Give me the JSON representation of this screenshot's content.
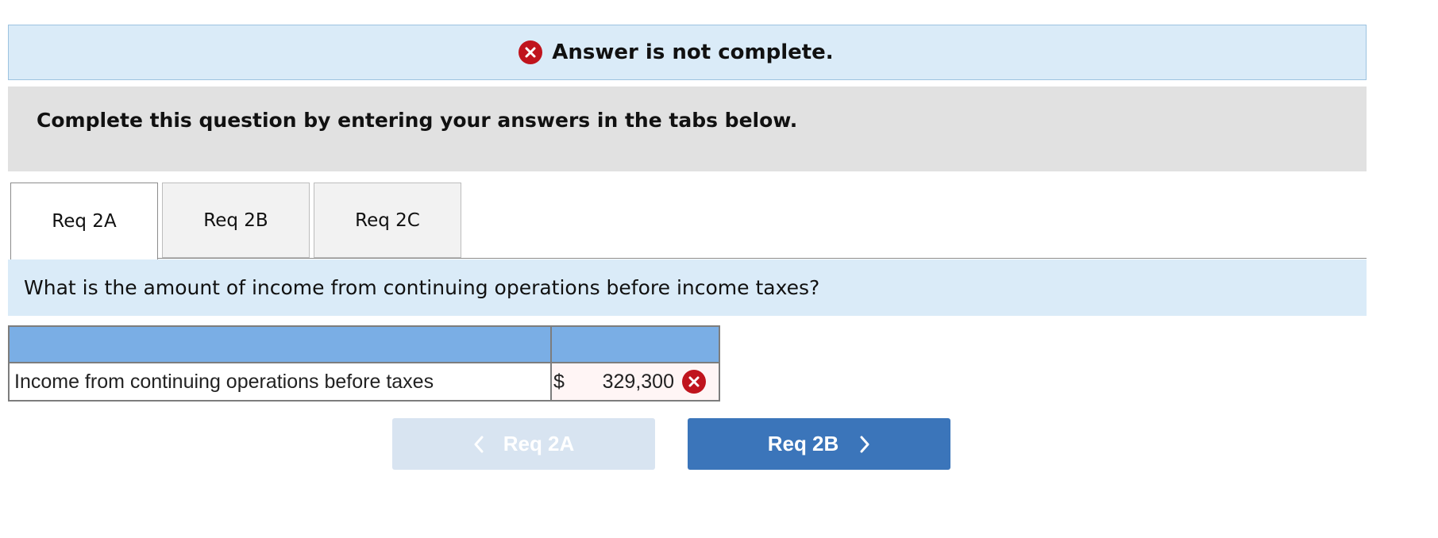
{
  "status_banner": {
    "message": "Answer is not complete.",
    "icon": "error-x-icon",
    "color": "#c0141d"
  },
  "instruction": {
    "text": "Complete this question by entering your answers in the tabs below."
  },
  "tabs": [
    {
      "label": "Req 2A",
      "active": true
    },
    {
      "label": "Req 2B",
      "active": false
    },
    {
      "label": "Req 2C",
      "active": false
    }
  ],
  "question": {
    "text": "What is the amount of income from continuing operations before income taxes?"
  },
  "answer_table": {
    "headers": [
      "",
      ""
    ],
    "rows": [
      {
        "label": "Income from continuing operations before taxes",
        "currency": "$",
        "value": "329,300",
        "status": "incorrect",
        "status_icon": "error-x-icon"
      }
    ]
  },
  "navigation": {
    "prev_label": "Req 2A",
    "next_label": "Req 2B",
    "prev_icon": "chevron-left-icon",
    "next_icon": "chevron-right-icon"
  },
  "colors": {
    "banner_bg": "#daebf8",
    "instruction_bg": "#e1e1e1",
    "table_header_bg": "#7aaee5",
    "next_button_bg": "#3b75ba",
    "prev_button_bg": "#d8e4f1",
    "error": "#c0141d"
  }
}
